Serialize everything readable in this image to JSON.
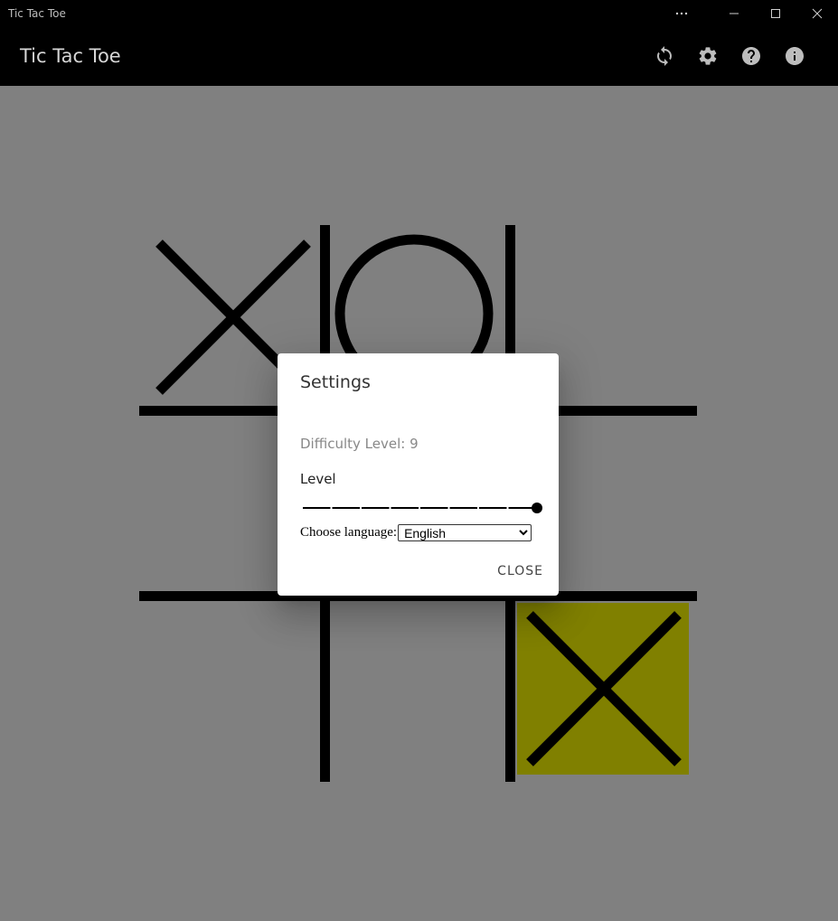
{
  "window": {
    "title": "Tic Tac Toe",
    "controls": [
      "more-icon",
      "minimize-icon",
      "maximize-icon",
      "close-icon"
    ]
  },
  "appbar": {
    "title": "Tic Tac Toe",
    "actions": [
      "refresh-icon",
      "gear-icon",
      "help-icon",
      "info-icon"
    ]
  },
  "board": {
    "cells": [
      "X",
      "O",
      "",
      "",
      "",
      "",
      "",
      "",
      "X"
    ],
    "winning_cell_index": 8,
    "colors": {
      "background": "#808080",
      "lines": "#000000",
      "highlight": "#808000"
    }
  },
  "settings_dialog": {
    "title": "Settings",
    "difficulty_text": "Difficulty Level: 9",
    "level_label": "Level",
    "level_value": 9,
    "level_min": 1,
    "level_max": 9,
    "language_label": "Choose language:",
    "language_selected": "English",
    "close_label": "CLOSE"
  }
}
